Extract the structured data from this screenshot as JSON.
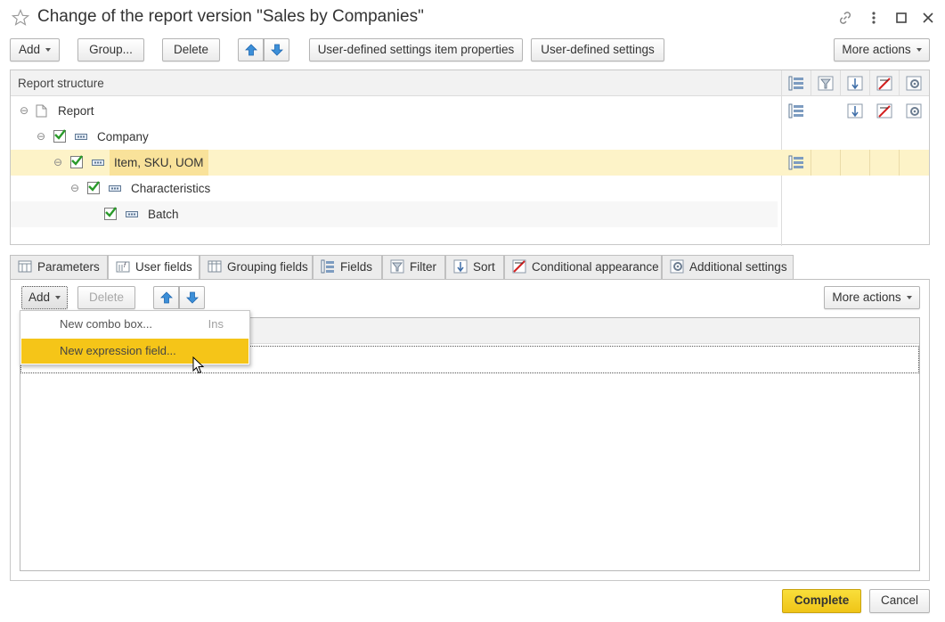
{
  "window": {
    "title": "Change of the report version \"Sales by Companies\"",
    "star_icon": "star-icon",
    "link_icon": "link-icon",
    "more_icon": "vertical-dots-icon",
    "maximize_icon": "maximize-icon",
    "close_icon": "close-icon"
  },
  "toolbar": {
    "add_label": "Add",
    "group_label": "Group...",
    "delete_label": "Delete",
    "item_properties_label": "User-defined settings item properties",
    "user_settings_label": "User-defined settings",
    "more_actions_label": "More actions"
  },
  "structure": {
    "header": "Report structure",
    "rows": [
      {
        "label": "Report"
      },
      {
        "label": "Company"
      },
      {
        "label": "Item, SKU, UOM"
      },
      {
        "label": "Characteristics"
      },
      {
        "label": "Batch"
      }
    ]
  },
  "tabs": [
    {
      "label": "Parameters",
      "icon": "parameters-icon"
    },
    {
      "label": "User fields",
      "icon": "user-fields-icon"
    },
    {
      "label": "Grouping fields",
      "icon": "grouping-fields-icon"
    },
    {
      "label": "Fields",
      "icon": "fields-icon"
    },
    {
      "label": "Filter",
      "icon": "filter-icon"
    },
    {
      "label": "Sort",
      "icon": "sort-icon"
    },
    {
      "label": "Conditional appearance",
      "icon": "conditional-appearance-icon"
    },
    {
      "label": "Additional settings",
      "icon": "additional-settings-icon"
    }
  ],
  "active_tab": "User fields",
  "subtoolbar": {
    "add_label": "Add",
    "delete_label": "Delete",
    "more_actions_label": "More actions"
  },
  "dropdown": {
    "items": [
      {
        "label": "New combo box...",
        "shortcut": "Ins"
      },
      {
        "label": "New expression field...",
        "shortcut": ""
      }
    ]
  },
  "footer": {
    "complete_label": "Complete",
    "cancel_label": "Cancel"
  },
  "colors": {
    "highlight_row": "#fdf3c8",
    "menu_highlight": "#f5c518",
    "complete_button": "#f5d327",
    "check_green": "#2a9a2a"
  }
}
